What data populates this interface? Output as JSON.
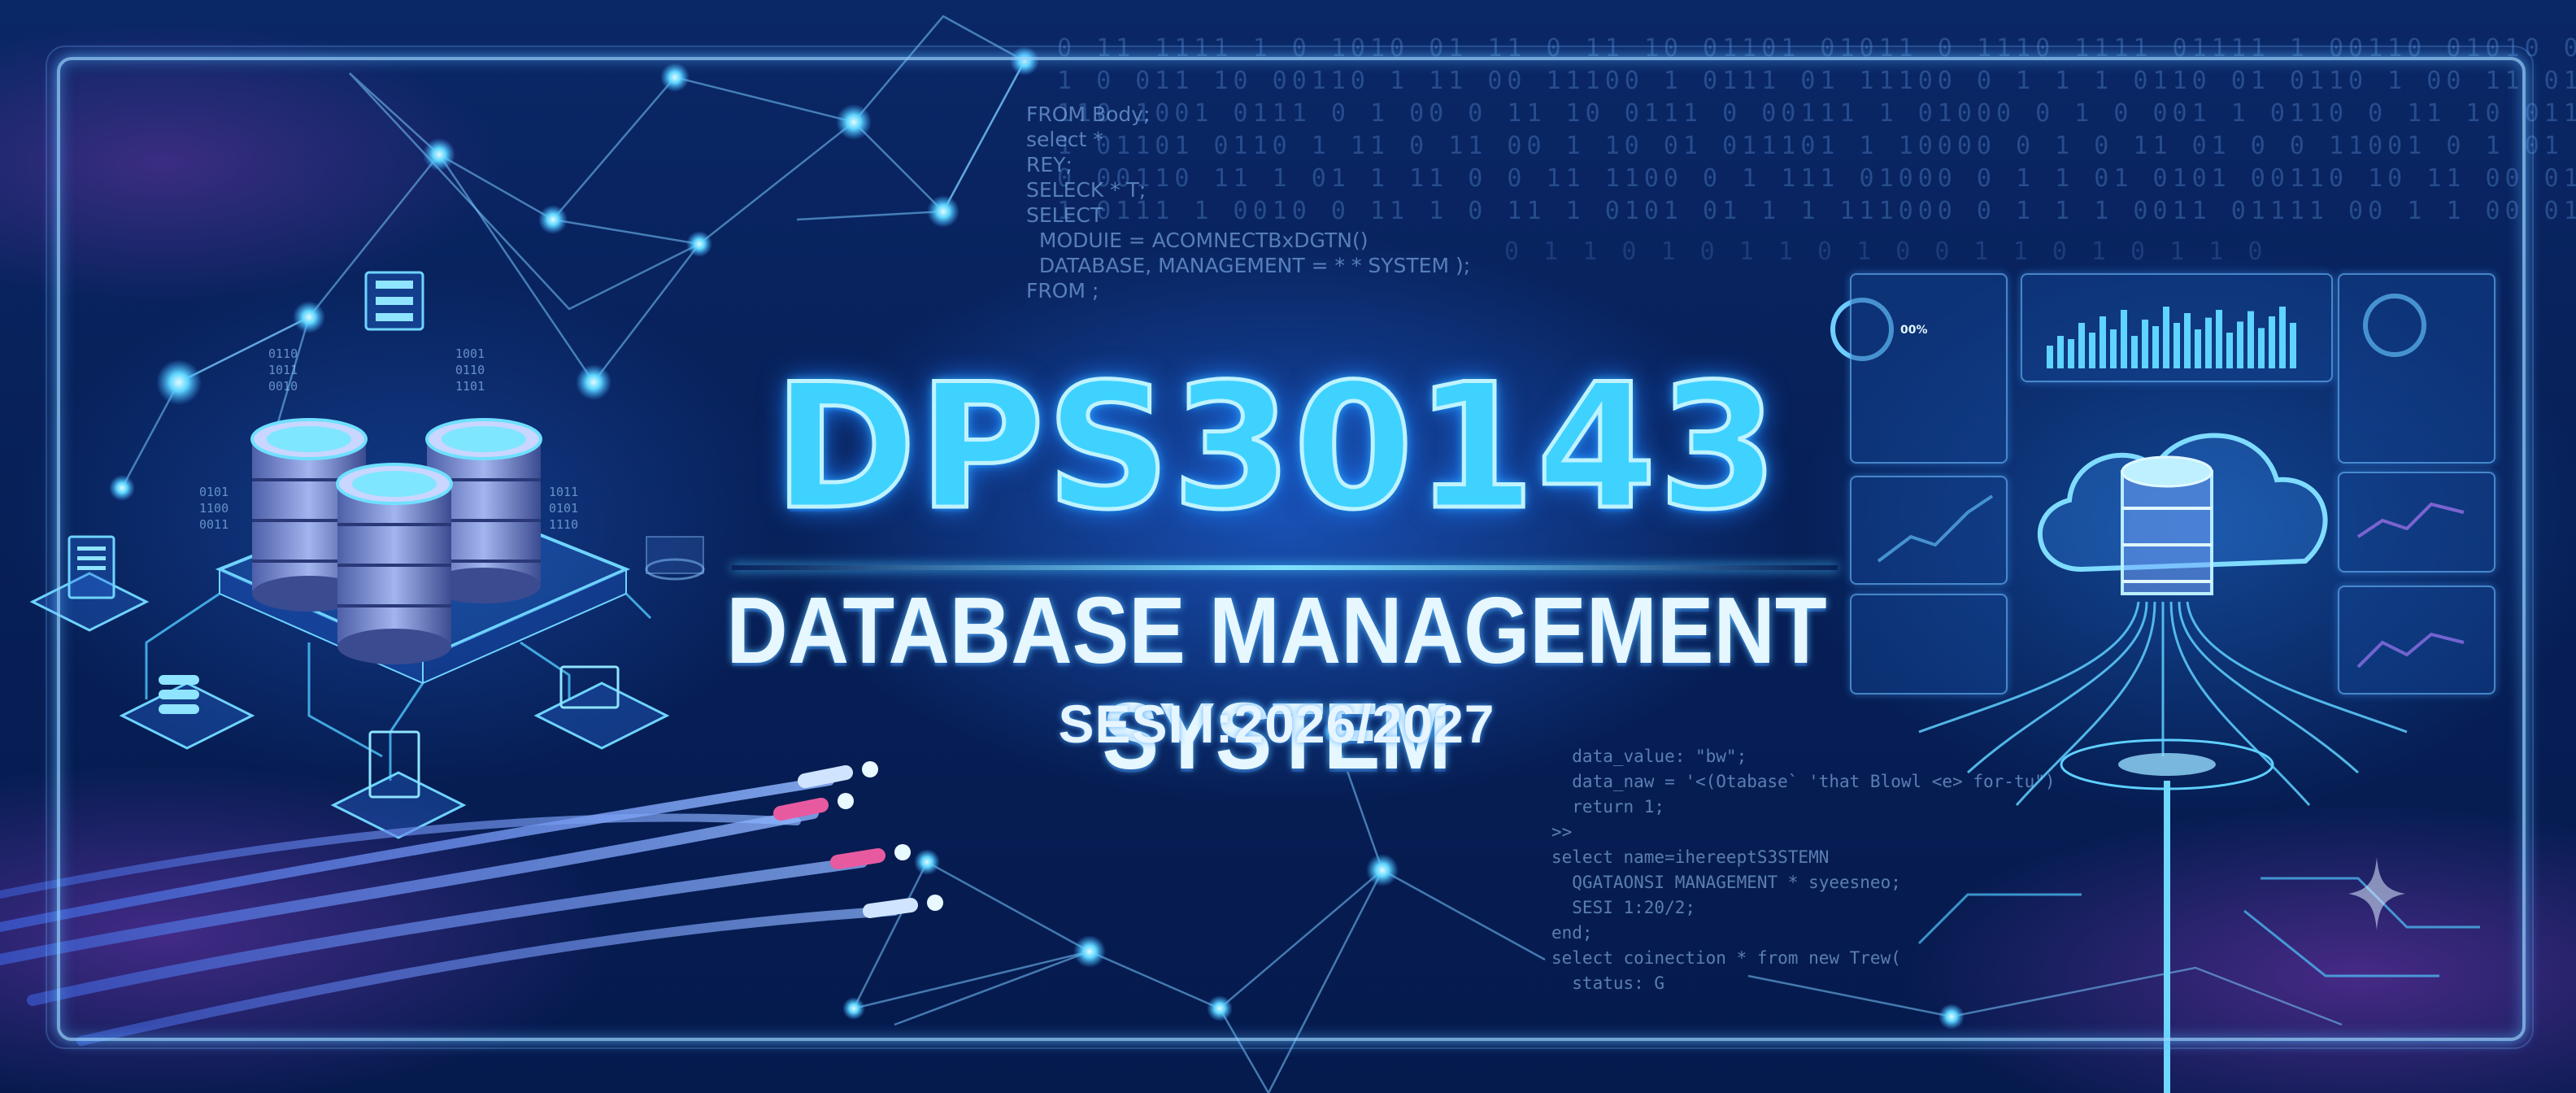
{
  "banner": {
    "course_code": "DPS30143",
    "course_name": "DATABASE MANAGEMENT SYSTEM",
    "session": "SESI I:2026/2027"
  },
  "background_code": [
    "FROM Body;",
    "select *",
    "REY;",
    "SELECK * T;",
    "SELECT",
    "  MODUIE = ACOMNECTBxDGTN()",
    "  DATABASE, MANAGEMENT = * * SYSTEM );",
    "FROM ;"
  ],
  "background_code_2": [
    "  data_value: \"bw\";",
    "  data_naw = '<(Otabase` 'that Blowl <e> for-tu\")",
    "  return 1;",
    ">>",
    "",
    "select name=ihereeptS3STEMN",
    "  QGATAONSI MANAGEMENT * syeesneo;",
    "  SESI 1:20/2;",
    "end;",
    "",
    "select coinection * from new Trew(",
    "  status: G"
  ],
  "dashboard": {
    "gauge_value": "00%",
    "bar_values": [
      0.35,
      0.5,
      0.45,
      0.7,
      0.55,
      0.8,
      0.6,
      0.9,
      0.5,
      0.75,
      0.65,
      0.95,
      0.7,
      0.85,
      0.6,
      0.78,
      0.9,
      0.55,
      0.72,
      0.88,
      0.62,
      0.8,
      0.95,
      0.7
    ]
  },
  "colors": {
    "title_fill": "#3fd2ff",
    "title_stroke": "#bff3ff",
    "background": "#072058",
    "frame": "#96d2ff"
  },
  "icons": [
    "database-stack-icon",
    "cloud-database-icon",
    "server-rack-icon",
    "network-node-icon",
    "document-icon",
    "sparkle-icon"
  ]
}
